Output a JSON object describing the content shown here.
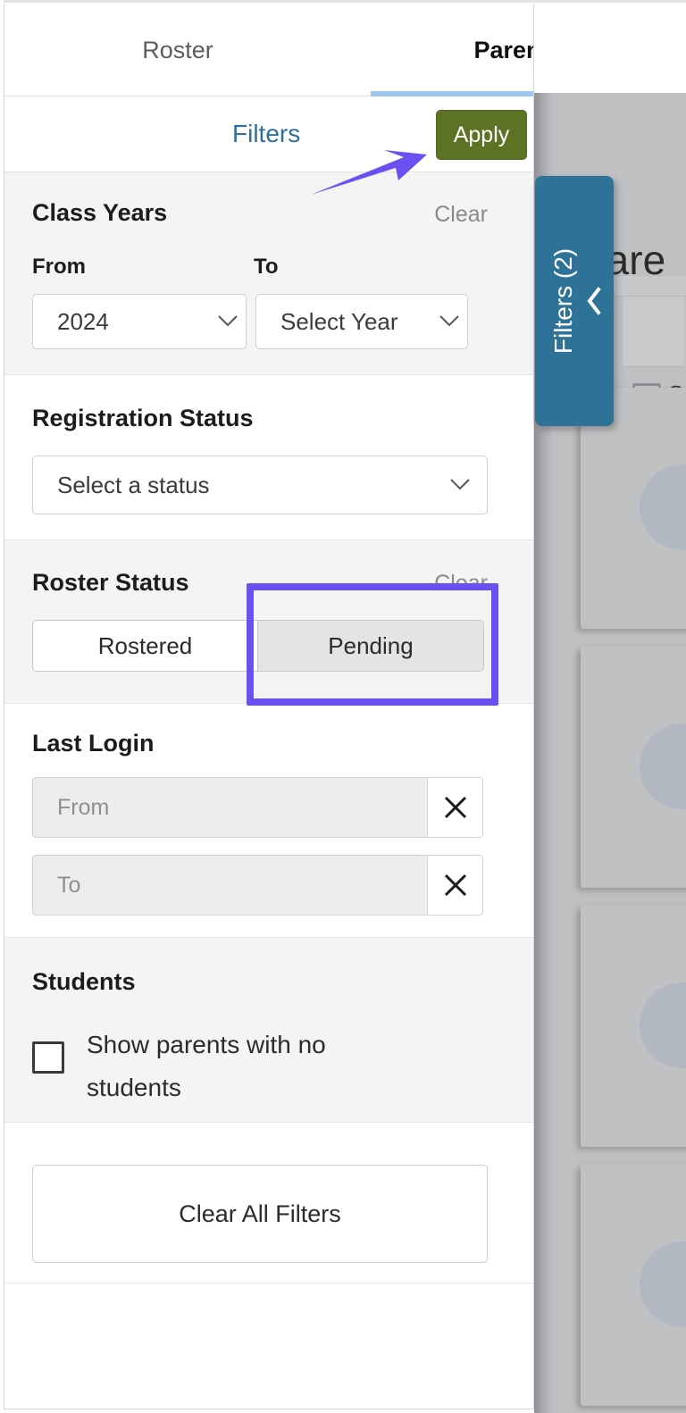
{
  "tabs": [
    {
      "label": "Roster",
      "active": false
    },
    {
      "label": "Parents",
      "active": true
    }
  ],
  "filters_bar": {
    "title": "Filters",
    "apply_label": "Apply"
  },
  "sections": {
    "class_years": {
      "title": "Class Years",
      "clear_label": "Clear",
      "from_label": "From",
      "to_label": "To",
      "from_value": "2024",
      "to_value": "Select Year"
    },
    "registration_status": {
      "title": "Registration Status",
      "value": "Select a status"
    },
    "roster_status": {
      "title": "Roster Status",
      "clear_label": "Clear",
      "options": [
        {
          "label": "Rostered",
          "selected": false
        },
        {
          "label": "Pending",
          "selected": true
        }
      ]
    },
    "last_login": {
      "title": "Last Login",
      "from_placeholder": "From",
      "from_value": "",
      "to_placeholder": "To",
      "to_value": "",
      "clear_icon": "close-x-icon"
    },
    "students": {
      "title": "Students",
      "checkbox_label": "Show parents with no students",
      "checked": false
    }
  },
  "clear_all_label": "Clear All Filters",
  "filters_handle": {
    "label": "Filters (2)",
    "chevron_icon": "chevron-left-icon"
  },
  "background_page": {
    "title": "Pare",
    "checkbox_label": "S"
  },
  "annotations": {
    "arrow_color": "#6c4ff0",
    "highlight_box_color": "#6c4ff0",
    "arrow_target": "apply-button",
    "highlight_target": "roster-status-pending-button"
  },
  "colors": {
    "apply_green": "#5c7326",
    "tab_underline_blue": "#9fc6ec",
    "filters_link_blue": "#2f6f9e",
    "handle_teal": "#2f7298",
    "annotation_purple": "#6c4ff0"
  }
}
